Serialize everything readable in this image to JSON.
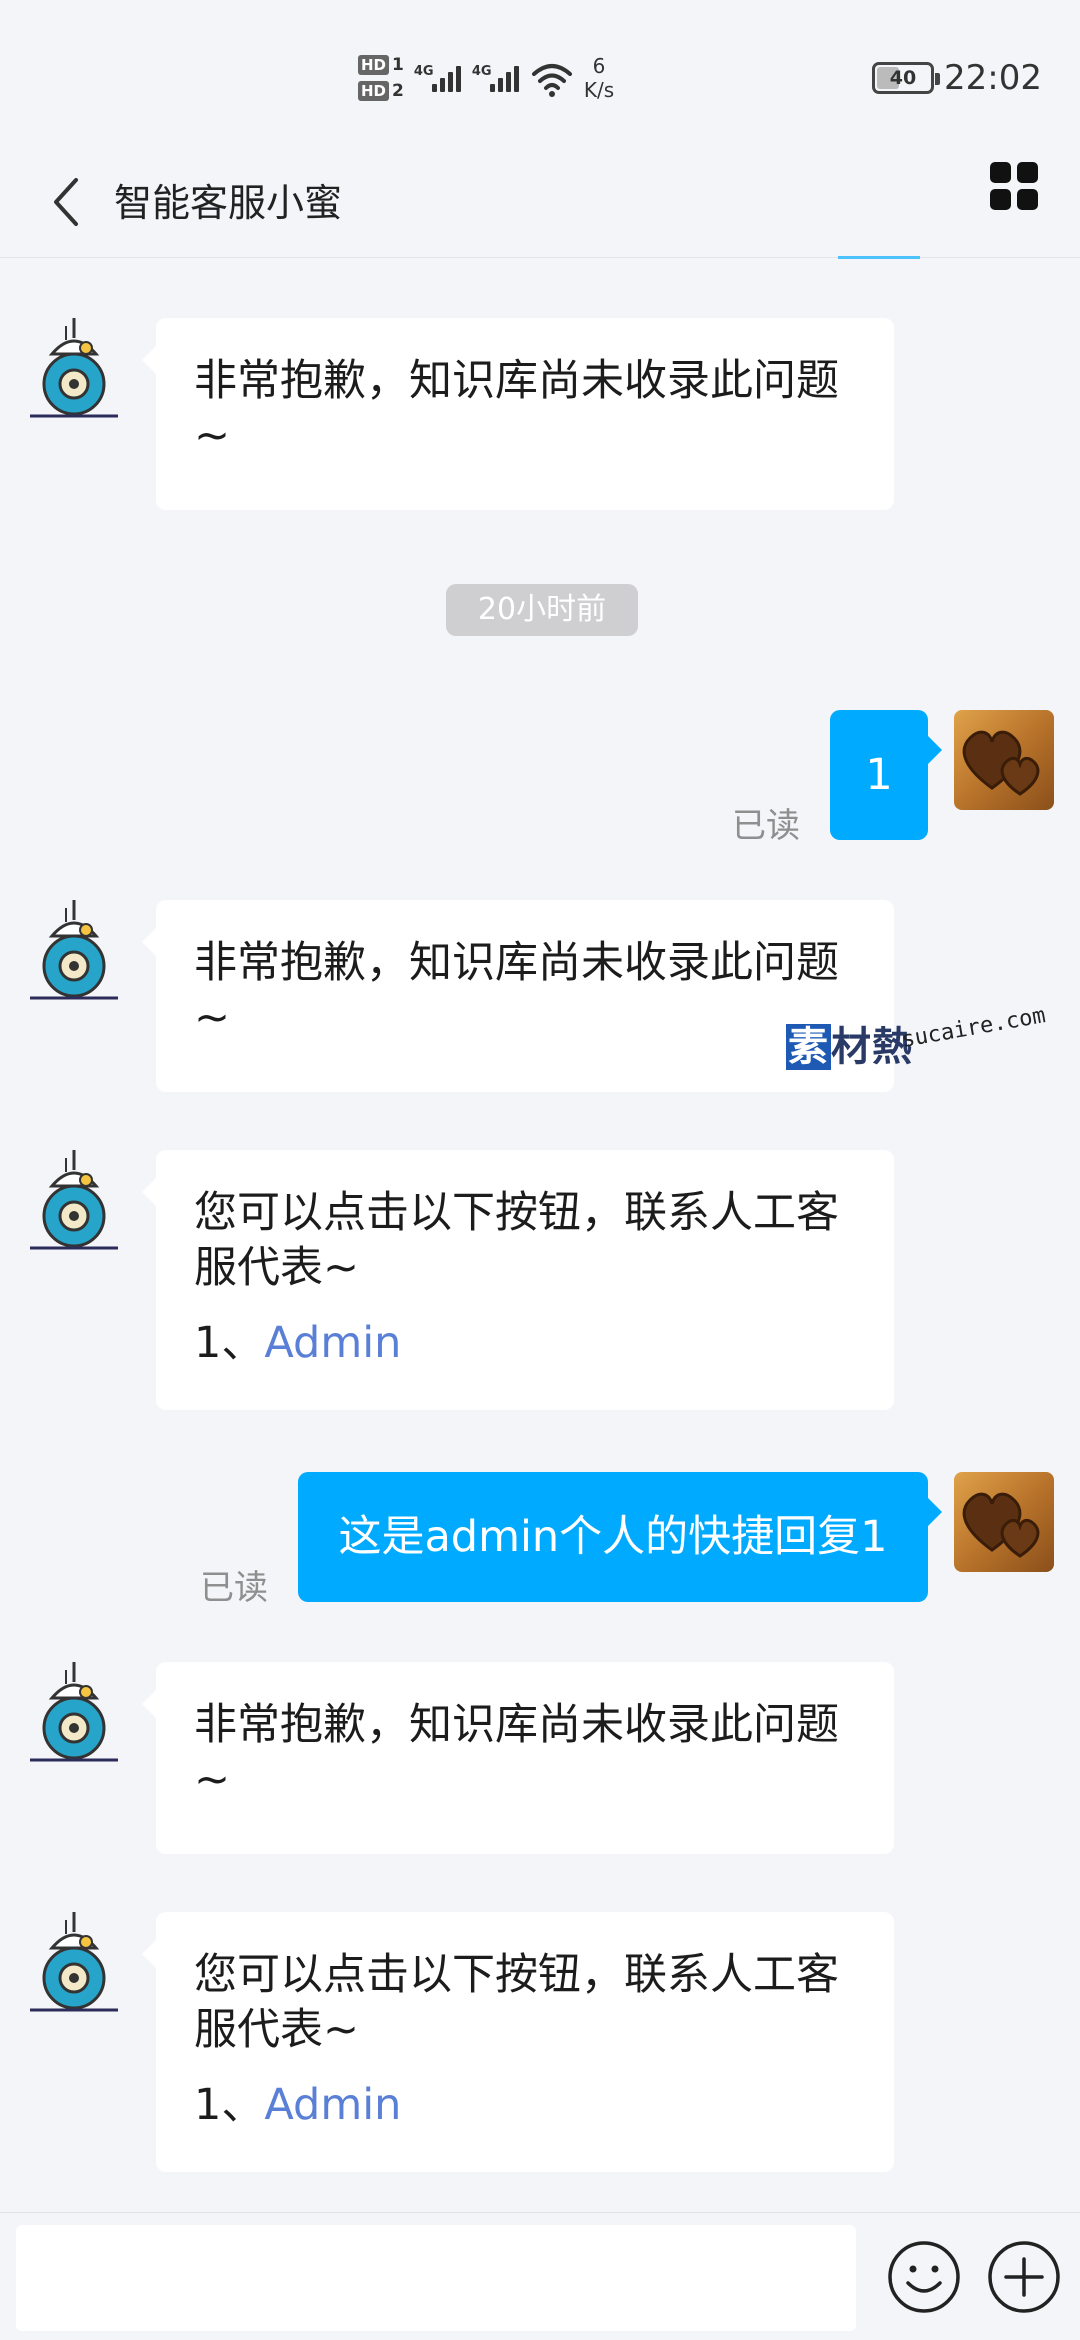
{
  "status_bar": {
    "sim1": "HD",
    "sim1_num": "1",
    "sim2": "HD",
    "sim2_num": "2",
    "network1": "4G",
    "network2": "4G",
    "speed_value": "6",
    "speed_unit": "K/s",
    "battery": "40",
    "time": "22:02"
  },
  "header": {
    "title": "智能客服小蜜",
    "back_icon": "chevron-left-icon",
    "menu_icon": "grid-icon"
  },
  "messages": [
    {
      "side": "bot",
      "text": "非常抱歉，知识库尚未收录此问题~"
    },
    {
      "side": "time",
      "text": "20小时前"
    },
    {
      "side": "user",
      "text": "1",
      "read": "已读"
    },
    {
      "side": "bot",
      "text": "非常抱歉，知识库尚未收录此问题~"
    },
    {
      "side": "bot",
      "text": "您可以点击以下按钮，联系人工客服代表~",
      "link_prefix": "1、",
      "link": "Admin"
    },
    {
      "side": "user",
      "text": "这是admin个人的快捷回复1",
      "read": "已读"
    },
    {
      "side": "bot",
      "text": "非常抱歉，知识库尚未收录此问题~"
    },
    {
      "side": "bot",
      "text": "您可以点击以下按钮，联系人工客服代表~",
      "link_prefix": "1、",
      "link": "Admin"
    }
  ],
  "watermark": {
    "logo_first": "素",
    "logo_rest": "材熱",
    "site": "sucaire.com"
  },
  "input_bar": {
    "emoji_icon": "smiley-icon",
    "plus_icon": "plus-icon"
  },
  "colors": {
    "accent": "#00aaff",
    "link": "#5a7fd6",
    "background": "#f4f5f8"
  }
}
